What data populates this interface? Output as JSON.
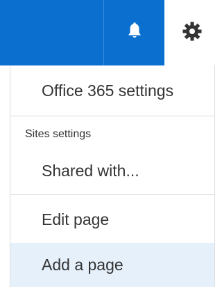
{
  "topbar": {
    "accent_color": "#0a6fcf",
    "bell_icon": "bell-icon",
    "gear_icon": "gear-icon"
  },
  "menu": {
    "office365_settings": "Office 365 settings",
    "sites_settings_label": "Sites settings",
    "shared_with": "Shared with...",
    "edit_page": "Edit page",
    "add_a_page": "Add a page",
    "hover_color": "#e6f0fb"
  }
}
